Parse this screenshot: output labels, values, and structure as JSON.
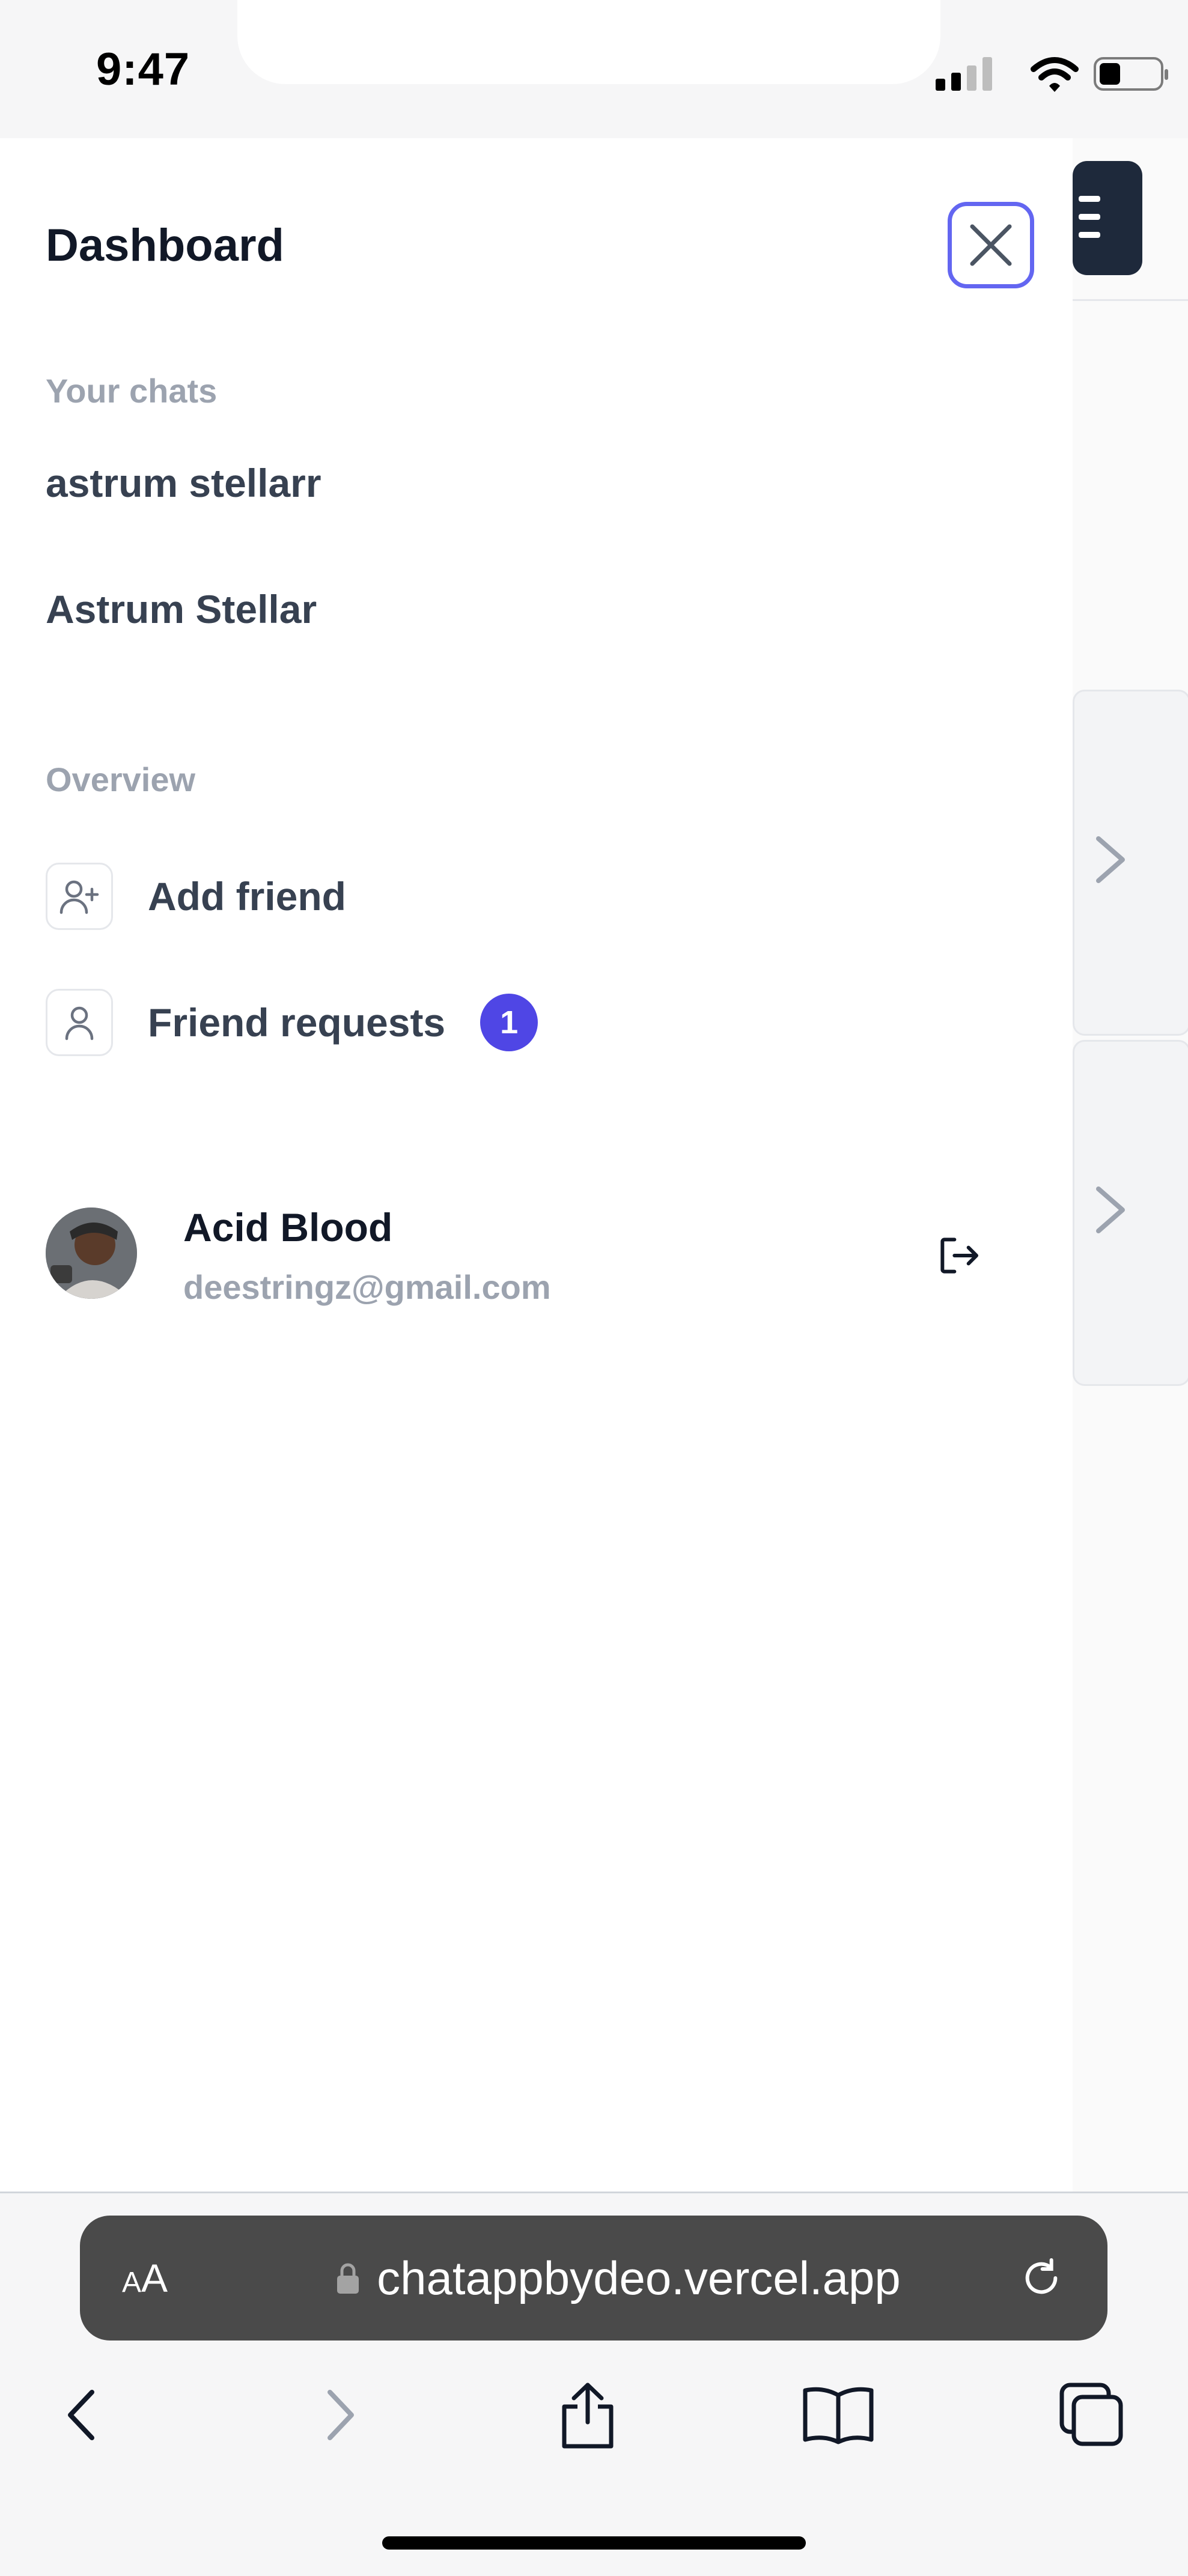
{
  "status_bar": {
    "time": "9:47"
  },
  "drawer": {
    "title": "Dashboard",
    "chats_label": "Your chats",
    "chats": [
      {
        "name": "astrum stellarr"
      },
      {
        "name": "Astrum Stellar"
      }
    ],
    "overview_label": "Overview",
    "overview_items": [
      {
        "label": "Add friend",
        "icon": "user-plus-icon"
      },
      {
        "label": "Friend requests",
        "icon": "user-icon",
        "badge": "1"
      }
    ],
    "user": {
      "name": "Acid Blood",
      "email": "deestringz@gmail.com"
    }
  },
  "browser": {
    "text_size_label_small": "A",
    "text_size_label_large": "A",
    "url": "chatappbydeo.vercel.app"
  },
  "colors": {
    "accent": "#4f46e5",
    "close_border": "#6366f1",
    "header_dark": "#1e293b",
    "muted_text": "#9ca3af"
  }
}
